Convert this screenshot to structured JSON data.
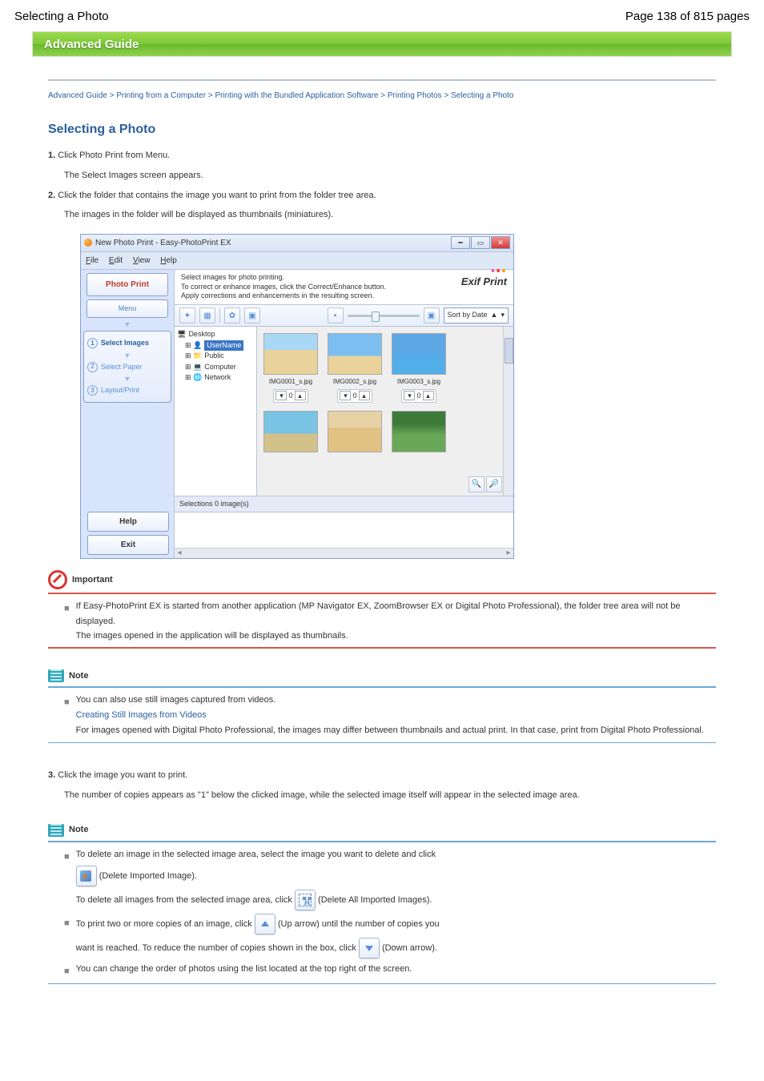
{
  "topbar": {
    "left": "Selecting a Photo",
    "right": "Page 138 of 815 pages"
  },
  "band": "Advanced Guide",
  "breadcrumbs": "Advanced Guide > Printing from a Computer > Printing with the Bundled Application Software > Printing Photos > Selecting a Photo",
  "title": "Selecting a Photo",
  "steps": [
    "Click Photo Print from Menu.",
    "The Select Images screen appears.",
    "Click the folder that contains the image you want to print from the folder tree area."
  ],
  "steps_trail": "The images in the folder will be displayed as thumbnails (miniatures).",
  "screenshot": {
    "title": "New Photo Print - Easy-PhotoPrint EX",
    "menus": [
      "File",
      "Edit",
      "View",
      "Help"
    ],
    "left": {
      "photo_print": "Photo Print",
      "menu": "Menu",
      "steps": {
        "s1": "Select Images",
        "s2": "Select Paper",
        "s3": "Layout/Print"
      },
      "help": "Help",
      "exit": "Exit"
    },
    "instr": [
      "Select images for photo printing.",
      "To correct or enhance images, click the Correct/Enhance button.",
      "Apply corrections and enhancements in the resulting screen."
    ],
    "exif": "Exif Print",
    "toolbar": {
      "sort": "Sort by Date",
      "asc": "▲"
    },
    "tree": {
      "root": "Desktop",
      "user": "UserName",
      "public": "Public",
      "computer": "Computer",
      "network": "Network"
    },
    "thumbs": [
      "IMG0001_s.jpg",
      "IMG0002_s.jpg",
      "IMG0003_s.jpg"
    ],
    "selections": "Selections 0 image(s)"
  },
  "important": {
    "label": "Important",
    "item1a": "If Easy-PhotoPrint EX is started from another application (MP Navigator EX, ZoomBrowser EX or Digital Photo Professional), the folder tree area will not be displayed.",
    "item1b": "The images opened in the application will be displayed as thumbnails."
  },
  "note1": {
    "label": "Note",
    "item1": "You can also use still images captured from videos.",
    "link1": "Creating Still Images from Videos",
    "item2": "For images opened with Digital Photo Professional, the images may differ between thumbnails and actual print. In that case, print from Digital Photo Professional."
  },
  "step3": {
    "num": "3.",
    "text": "Click the image you want to print.",
    "p1": "The number of copies appears as \"1\" below the clicked image, while the selected image itself will appear in the selected image area.",
    "note_label": "Note",
    "n1a": "To delete an image in the selected image area, select the image you want to delete and click",
    "n1b": " (Delete Imported Image).",
    "n1c": "To delete all images from the selected image area, click ",
    "n1d": " (Delete All Imported Images).",
    "n2a": "To print two or more copies of an image, click ",
    "n2b": " (Up arrow) until the number of copies you ",
    "n2c": "want is reached. To reduce the number of copies shown in the box, click ",
    "n2d": " (Down arrow).",
    "n3": "You can change the order of photos using the list located at the top right of the screen."
  }
}
